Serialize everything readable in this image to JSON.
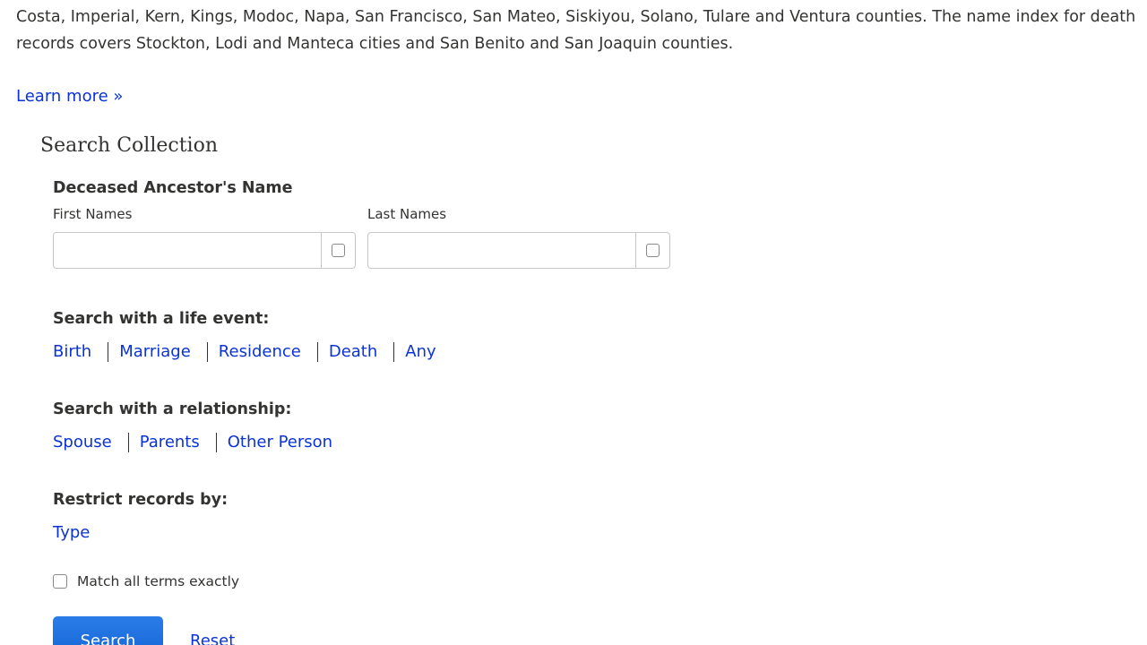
{
  "intro": {
    "text": "Costa, Imperial, Kern, Kings, Modoc, Napa, San Francisco, San Mateo, Siskiyou, Solano, Tulare and Ventura counties. The name index for death records covers Stockton, Lodi and Manteca cities and San Benito and San Joaquin counties.",
    "learn_more": "Learn more »"
  },
  "search": {
    "heading": "Search Collection",
    "name_section": {
      "title": "Deceased Ancestor's Name",
      "first_label": "First Names",
      "first_value": "",
      "last_label": "Last Names",
      "last_value": ""
    },
    "life_event": {
      "title": "Search with a life event:",
      "links": [
        "Birth",
        "Marriage",
        "Residence",
        "Death",
        "Any"
      ]
    },
    "relationship": {
      "title": "Search with a relationship:",
      "links": [
        "Spouse",
        "Parents",
        "Other Person"
      ]
    },
    "restrict": {
      "title": "Restrict records by:",
      "links": [
        "Type"
      ]
    },
    "match_exact": {
      "label": "Match all terms exactly",
      "checked": false
    },
    "buttons": {
      "search": "Search",
      "reset": "Reset"
    }
  },
  "colors": {
    "link": "#0b33d6",
    "text": "#333331",
    "button": "#1a73e8"
  }
}
